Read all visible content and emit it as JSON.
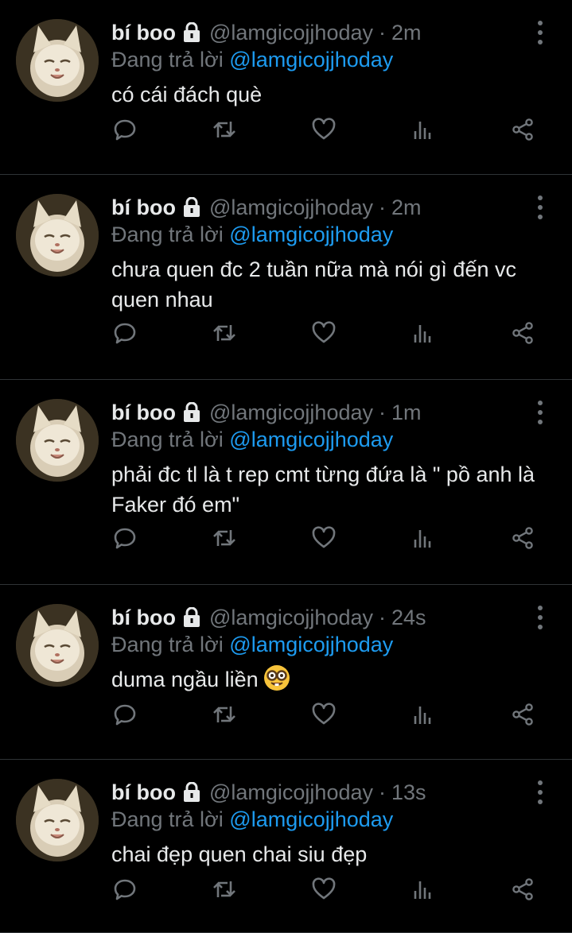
{
  "tweets": [
    {
      "name": "bí boo",
      "handle": "@lamgicojjhoday",
      "separator": "·",
      "time": "2m",
      "replying_prefix": "Đang trả lời",
      "replying_to": "@lamgicojjhoday",
      "text": "có cái đách què",
      "emoji": null
    },
    {
      "name": "bí boo",
      "handle": "@lamgicojjhoday",
      "separator": "·",
      "time": "2m",
      "replying_prefix": "Đang trả lời",
      "replying_to": "@lamgicojjhoday",
      "text": "chưa quen đc 2 tuần nữa mà nói gì đến vc quen nhau",
      "emoji": null
    },
    {
      "name": "bí boo",
      "handle": "@lamgicojjhoday",
      "separator": "·",
      "time": "1m",
      "replying_prefix": "Đang trả lời",
      "replying_to": "@lamgicojjhoday",
      "text": "phải đc tl là t rep cmt từng đứa là \" pồ anh là Faker đó em\"",
      "emoji": null
    },
    {
      "name": "bí boo",
      "handle": "@lamgicojjhoday",
      "separator": "·",
      "time": "24s",
      "replying_prefix": "Đang trả lời",
      "replying_to": "@lamgicojjhoday",
      "text": "duma ngầu liền",
      "emoji": "nerd-face-emoji"
    },
    {
      "name": "bí boo",
      "handle": "@lamgicojjhoday",
      "separator": "·",
      "time": "13s",
      "replying_prefix": "Đang trả lời",
      "replying_to": "@lamgicojjhoday",
      "text": "chai đẹp quen chai siu đẹp",
      "emoji": null
    }
  ],
  "icons": {
    "lock": "lock-icon",
    "more": "more-vertical-icon",
    "reply": "reply-icon",
    "retweet": "retweet-icon",
    "like": "heart-icon",
    "views": "analytics-icon",
    "share": "share-icon"
  },
  "colors": {
    "background": "#000000",
    "text": "#e7e9ea",
    "muted": "#71767b",
    "accent": "#1d9bf0",
    "divider": "#2f3336"
  }
}
